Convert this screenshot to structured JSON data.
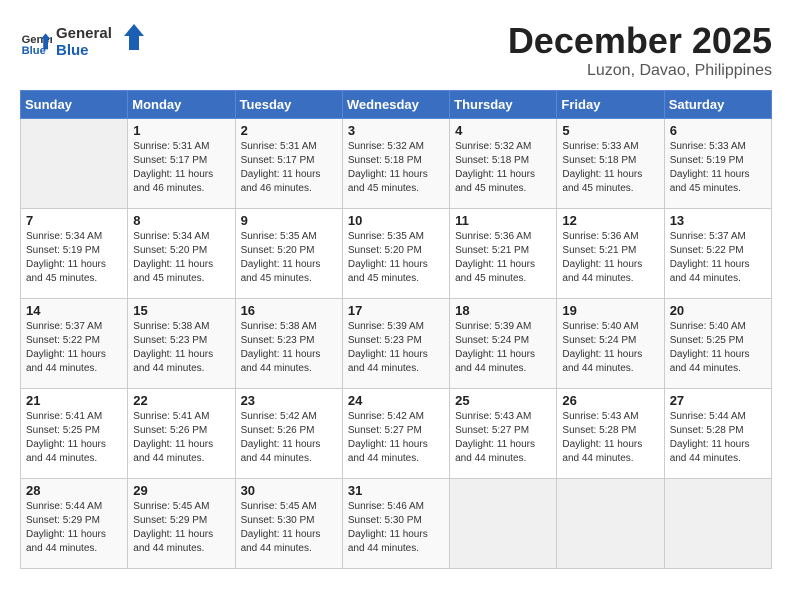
{
  "logo": {
    "text_general": "General",
    "text_blue": "Blue"
  },
  "title": "December 2025",
  "subtitle": "Luzon, Davao, Philippines",
  "headers": [
    "Sunday",
    "Monday",
    "Tuesday",
    "Wednesday",
    "Thursday",
    "Friday",
    "Saturday"
  ],
  "weeks": [
    [
      {
        "day": "",
        "info": ""
      },
      {
        "day": "1",
        "info": "Sunrise: 5:31 AM\nSunset: 5:17 PM\nDaylight: 11 hours\nand 46 minutes."
      },
      {
        "day": "2",
        "info": "Sunrise: 5:31 AM\nSunset: 5:17 PM\nDaylight: 11 hours\nand 46 minutes."
      },
      {
        "day": "3",
        "info": "Sunrise: 5:32 AM\nSunset: 5:18 PM\nDaylight: 11 hours\nand 45 minutes."
      },
      {
        "day": "4",
        "info": "Sunrise: 5:32 AM\nSunset: 5:18 PM\nDaylight: 11 hours\nand 45 minutes."
      },
      {
        "day": "5",
        "info": "Sunrise: 5:33 AM\nSunset: 5:18 PM\nDaylight: 11 hours\nand 45 minutes."
      },
      {
        "day": "6",
        "info": "Sunrise: 5:33 AM\nSunset: 5:19 PM\nDaylight: 11 hours\nand 45 minutes."
      }
    ],
    [
      {
        "day": "7",
        "info": "Sunrise: 5:34 AM\nSunset: 5:19 PM\nDaylight: 11 hours\nand 45 minutes."
      },
      {
        "day": "8",
        "info": "Sunrise: 5:34 AM\nSunset: 5:20 PM\nDaylight: 11 hours\nand 45 minutes."
      },
      {
        "day": "9",
        "info": "Sunrise: 5:35 AM\nSunset: 5:20 PM\nDaylight: 11 hours\nand 45 minutes."
      },
      {
        "day": "10",
        "info": "Sunrise: 5:35 AM\nSunset: 5:20 PM\nDaylight: 11 hours\nand 45 minutes."
      },
      {
        "day": "11",
        "info": "Sunrise: 5:36 AM\nSunset: 5:21 PM\nDaylight: 11 hours\nand 45 minutes."
      },
      {
        "day": "12",
        "info": "Sunrise: 5:36 AM\nSunset: 5:21 PM\nDaylight: 11 hours\nand 44 minutes."
      },
      {
        "day": "13",
        "info": "Sunrise: 5:37 AM\nSunset: 5:22 PM\nDaylight: 11 hours\nand 44 minutes."
      }
    ],
    [
      {
        "day": "14",
        "info": "Sunrise: 5:37 AM\nSunset: 5:22 PM\nDaylight: 11 hours\nand 44 minutes."
      },
      {
        "day": "15",
        "info": "Sunrise: 5:38 AM\nSunset: 5:23 PM\nDaylight: 11 hours\nand 44 minutes."
      },
      {
        "day": "16",
        "info": "Sunrise: 5:38 AM\nSunset: 5:23 PM\nDaylight: 11 hours\nand 44 minutes."
      },
      {
        "day": "17",
        "info": "Sunrise: 5:39 AM\nSunset: 5:23 PM\nDaylight: 11 hours\nand 44 minutes."
      },
      {
        "day": "18",
        "info": "Sunrise: 5:39 AM\nSunset: 5:24 PM\nDaylight: 11 hours\nand 44 minutes."
      },
      {
        "day": "19",
        "info": "Sunrise: 5:40 AM\nSunset: 5:24 PM\nDaylight: 11 hours\nand 44 minutes."
      },
      {
        "day": "20",
        "info": "Sunrise: 5:40 AM\nSunset: 5:25 PM\nDaylight: 11 hours\nand 44 minutes."
      }
    ],
    [
      {
        "day": "21",
        "info": "Sunrise: 5:41 AM\nSunset: 5:25 PM\nDaylight: 11 hours\nand 44 minutes."
      },
      {
        "day": "22",
        "info": "Sunrise: 5:41 AM\nSunset: 5:26 PM\nDaylight: 11 hours\nand 44 minutes."
      },
      {
        "day": "23",
        "info": "Sunrise: 5:42 AM\nSunset: 5:26 PM\nDaylight: 11 hours\nand 44 minutes."
      },
      {
        "day": "24",
        "info": "Sunrise: 5:42 AM\nSunset: 5:27 PM\nDaylight: 11 hours\nand 44 minutes."
      },
      {
        "day": "25",
        "info": "Sunrise: 5:43 AM\nSunset: 5:27 PM\nDaylight: 11 hours\nand 44 minutes."
      },
      {
        "day": "26",
        "info": "Sunrise: 5:43 AM\nSunset: 5:28 PM\nDaylight: 11 hours\nand 44 minutes."
      },
      {
        "day": "27",
        "info": "Sunrise: 5:44 AM\nSunset: 5:28 PM\nDaylight: 11 hours\nand 44 minutes."
      }
    ],
    [
      {
        "day": "28",
        "info": "Sunrise: 5:44 AM\nSunset: 5:29 PM\nDaylight: 11 hours\nand 44 minutes."
      },
      {
        "day": "29",
        "info": "Sunrise: 5:45 AM\nSunset: 5:29 PM\nDaylight: 11 hours\nand 44 minutes."
      },
      {
        "day": "30",
        "info": "Sunrise: 5:45 AM\nSunset: 5:30 PM\nDaylight: 11 hours\nand 44 minutes."
      },
      {
        "day": "31",
        "info": "Sunrise: 5:46 AM\nSunset: 5:30 PM\nDaylight: 11 hours\nand 44 minutes."
      },
      {
        "day": "",
        "info": ""
      },
      {
        "day": "",
        "info": ""
      },
      {
        "day": "",
        "info": ""
      }
    ]
  ]
}
